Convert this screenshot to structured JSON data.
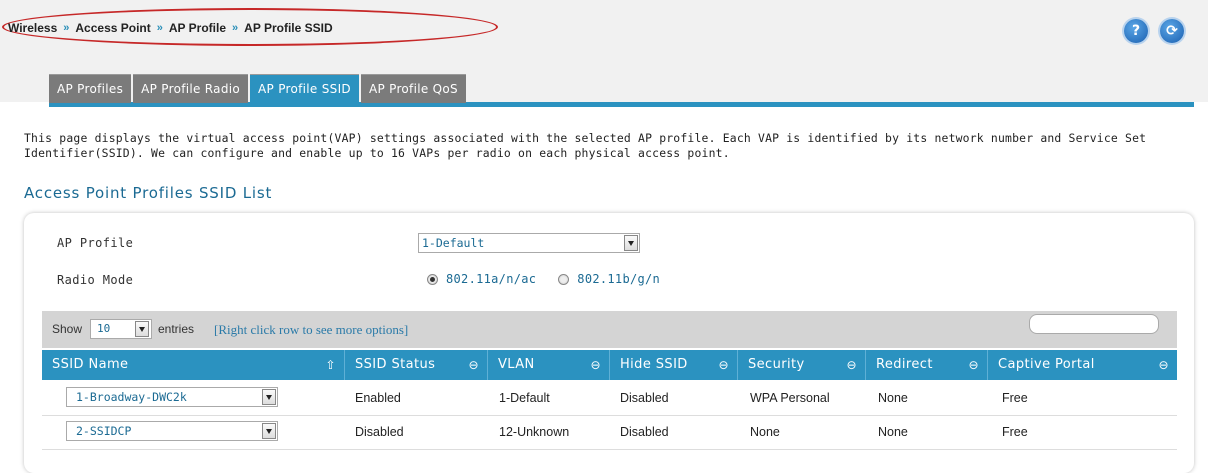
{
  "breadcrumb": {
    "items": [
      "Wireless",
      "Access Point",
      "AP Profile",
      "AP Profile SSID"
    ],
    "separator": "»"
  },
  "header_icons": {
    "help": "?",
    "refresh": "⟳"
  },
  "tabs": [
    {
      "label": "AP Profiles",
      "active": false
    },
    {
      "label": "AP Profile Radio",
      "active": false
    },
    {
      "label": "AP Profile SSID",
      "active": true
    },
    {
      "label": "AP Profile QoS",
      "active": false
    }
  ],
  "description": "This page displays the virtual access point(VAP) settings associated with the selected AP profile. Each VAP is identified by its network number and Service Set Identifier(SSID). We can configure and enable up to 16 VAPs per radio on each physical access point.",
  "section_title": "Access Point Profiles SSID List",
  "form": {
    "ap_profile_label": "AP Profile",
    "ap_profile_value": "1-Default",
    "radio_mode_label": "Radio Mode",
    "radio_options": [
      {
        "label": "802.11a/n/ac",
        "selected": true
      },
      {
        "label": "802.11b/g/n",
        "selected": false
      }
    ]
  },
  "toolbar": {
    "show_label": "Show",
    "length_value": "10",
    "entries_label": "entries",
    "hint": "[Right click row to see more options]"
  },
  "table": {
    "columns": [
      "SSID Name",
      "SSID Status",
      "VLAN",
      "Hide SSID",
      "Security",
      "Redirect",
      "Captive Portal"
    ],
    "rows": [
      {
        "ssid": "1-Broadway-DWC2k",
        "status": "Enabled",
        "vlan": "1-Default",
        "hide": "Disabled",
        "security": "WPA Personal",
        "redirect": "None",
        "captive": "Free"
      },
      {
        "ssid": "2-SSIDCP",
        "status": "Disabled",
        "vlan": "12-Unknown",
        "hide": "Disabled",
        "security": "None",
        "redirect": "None",
        "captive": "Free"
      }
    ]
  },
  "colors": {
    "accent": "#2b92c0",
    "tab_inactive": "#7b7b7b",
    "highlight_ellipse": "#c62828"
  }
}
